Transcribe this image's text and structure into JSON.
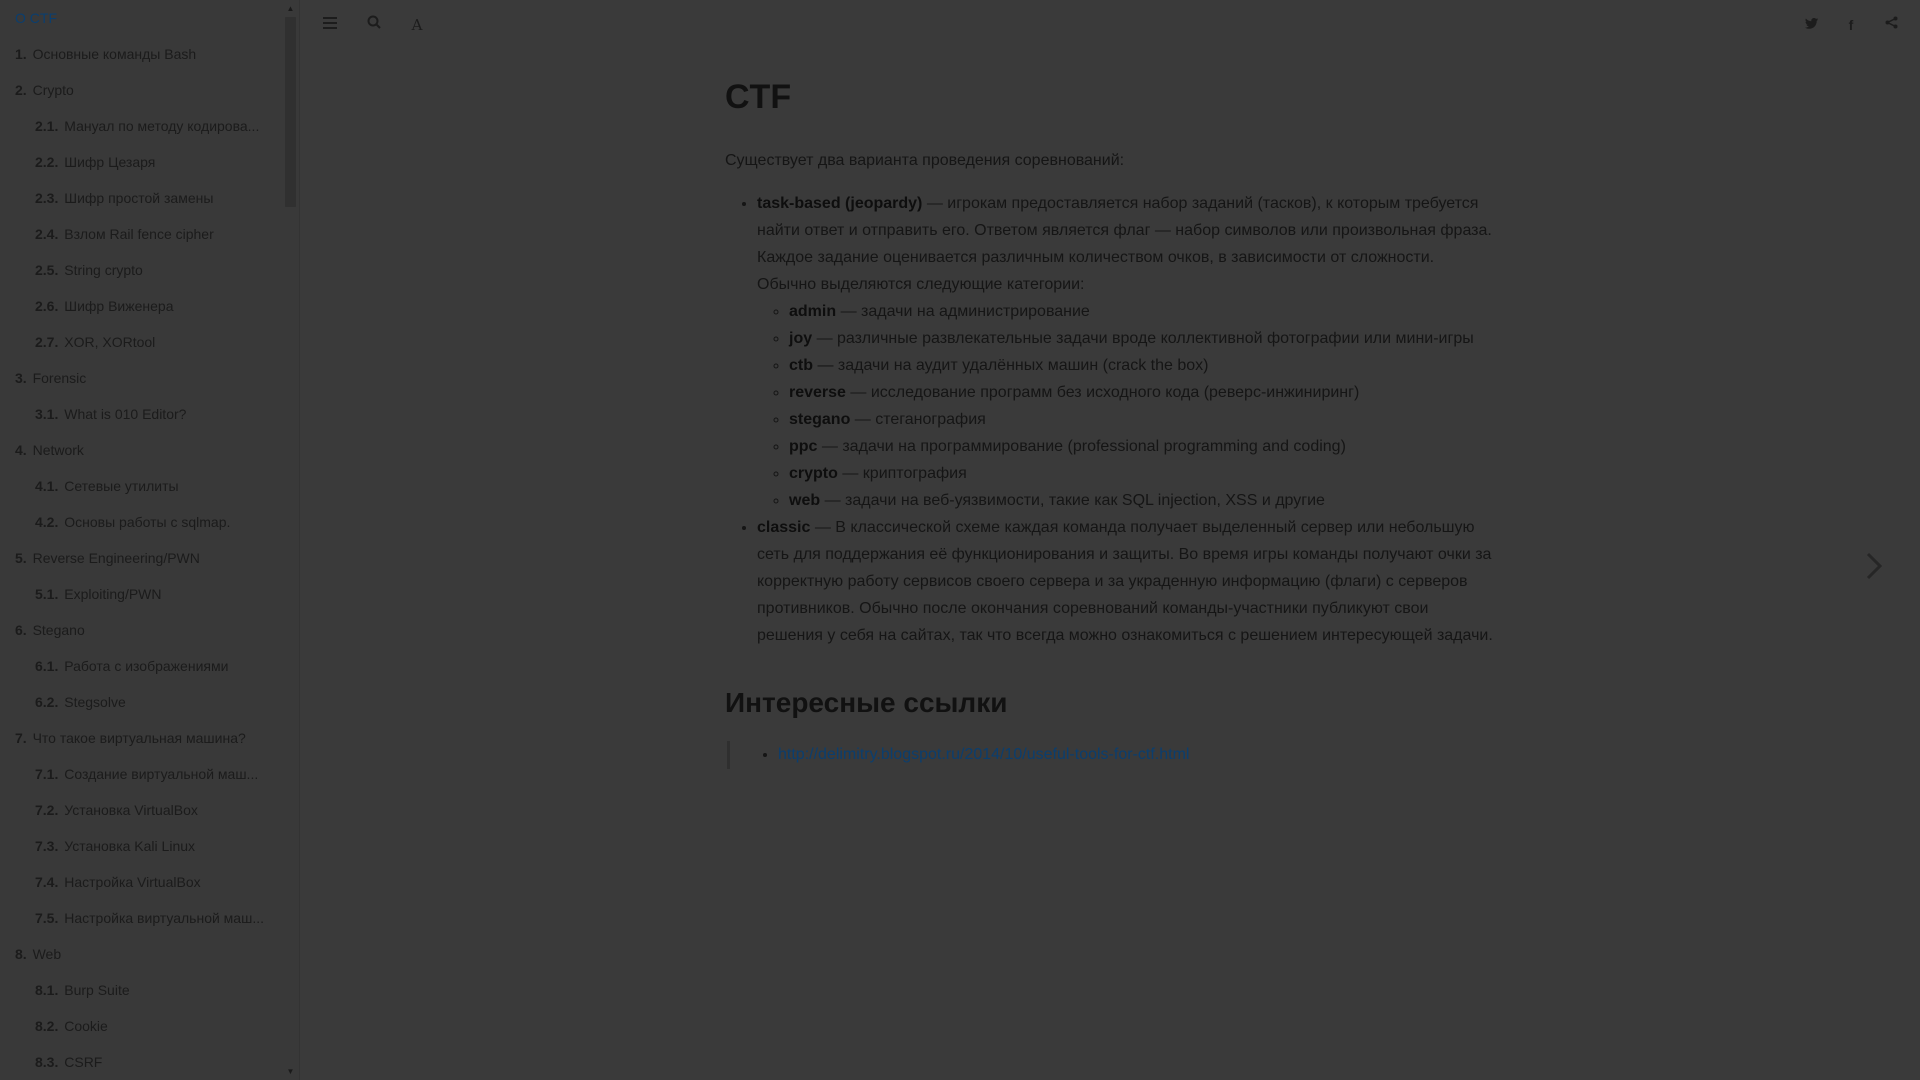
{
  "sidebar": {
    "items": [
      {
        "num": "",
        "label": "О CTF",
        "level": 1,
        "active": true
      },
      {
        "num": "1.",
        "label": "Основные команды Bash",
        "level": 1
      },
      {
        "num": "2.",
        "label": "Crypto",
        "level": 1
      },
      {
        "num": "2.1.",
        "label": "Мануал по методу кодирова...",
        "level": 2
      },
      {
        "num": "2.2.",
        "label": "Шифр Цезаря",
        "level": 2
      },
      {
        "num": "2.3.",
        "label": "Шифр простой замены",
        "level": 2
      },
      {
        "num": "2.4.",
        "label": "Взлом Rail fence cipher",
        "level": 2
      },
      {
        "num": "2.5.",
        "label": "String crypto",
        "level": 2
      },
      {
        "num": "2.6.",
        "label": "Шифр Виженера",
        "level": 2
      },
      {
        "num": "2.7.",
        "label": "XOR, XORtool",
        "level": 2
      },
      {
        "num": "3.",
        "label": "Forensic",
        "level": 1
      },
      {
        "num": "3.1.",
        "label": "What is 010 Editor?",
        "level": 2
      },
      {
        "num": "4.",
        "label": "Network",
        "level": 1
      },
      {
        "num": "4.1.",
        "label": "Сетевые утилиты",
        "level": 2
      },
      {
        "num": "4.2.",
        "label": "Основы работы с sqlmap.",
        "level": 2
      },
      {
        "num": "5.",
        "label": "Reverse Engineering/PWN",
        "level": 1
      },
      {
        "num": "5.1.",
        "label": "Exploiting/PWN",
        "level": 2
      },
      {
        "num": "6.",
        "label": "Stegano",
        "level": 1
      },
      {
        "num": "6.1.",
        "label": "Работа с изображениями",
        "level": 2
      },
      {
        "num": "6.2.",
        "label": "Stegsolve",
        "level": 2
      },
      {
        "num": "7.",
        "label": "Что такое виртуальная машина?",
        "level": 1
      },
      {
        "num": "7.1.",
        "label": "Создание виртуальной маш...",
        "level": 2
      },
      {
        "num": "7.2.",
        "label": "Установка VirtualBox",
        "level": 2
      },
      {
        "num": "7.3.",
        "label": "Установка Kali Linux",
        "level": 2
      },
      {
        "num": "7.4.",
        "label": "Настройка VirtualBox",
        "level": 2
      },
      {
        "num": "7.5.",
        "label": "Настройка виртуальной маш...",
        "level": 2
      },
      {
        "num": "8.",
        "label": "Web",
        "level": 1
      },
      {
        "num": "8.1.",
        "label": "Burp Suite",
        "level": 2
      },
      {
        "num": "8.2.",
        "label": "Cookie",
        "level": 2
      },
      {
        "num": "8.3.",
        "label": "CSRF",
        "level": 2
      }
    ]
  },
  "header": {
    "icons": [
      "menu-icon",
      "search-icon",
      "font-settings-icon",
      "twitter-icon",
      "facebook-icon",
      "share-icon"
    ]
  },
  "content": {
    "title": "CTF",
    "intro": "Существует два варианта проведения соревнований:",
    "taskbased": {
      "term": "task-based (jeopardy)",
      "desc": " — игрокам предоставляется набор заданий (тасков), к которым требуется найти ответ и отправить его. Ответом является флаг — набор символов или произвольная фраза. Каждое задание оценивается различным количеством очков, в зависимости от сложности. Обычно выделяются следующие категории:"
    },
    "categories": [
      {
        "term": "admin",
        "desc": " — задачи на администрирование"
      },
      {
        "term": "joy",
        "desc": " — различные развлекательные задачи вроде коллективной фотографии или мини-игры"
      },
      {
        "term": "ctb",
        "desc": " — задачи на аудит удалённых машин (crack the box)"
      },
      {
        "term": "reverse",
        "desc": " — исследование программ без исходного кода (реверс-инжиниринг)"
      },
      {
        "term": "stegano",
        "desc": " — стеганография"
      },
      {
        "term": "ppc",
        "desc": " — задачи на программирование (professional programming and coding)"
      },
      {
        "term": "crypto",
        "desc": " — криптография"
      },
      {
        "term": "web",
        "desc": " — задачи на веб-уязвимости, такие как SQL injection, XSS и другие"
      }
    ],
    "classic": {
      "term": "classic",
      "desc": " — В классической схеме каждая команда получает выделенный сервер или небольшую сеть для поддержания её функционирования и защиты. Во время игры команды получают очки за корректную работу сервисов своего сервера и за украденную информацию (флаги) с серверов противников. Обычно после окончания соревнований команды-участники публикуют свои решения у себя на сайтах, так что всегда можно ознакомиться с решением интересующей задачи."
    },
    "links_title": "Интересные ссылки",
    "links": [
      "http://delimitry.blogspot.ru/2014/10/useful-tools-for-ctf.html"
    ]
  },
  "colors": {
    "overlay_background": "#3a3a3a",
    "link": "#0b3e6e"
  }
}
